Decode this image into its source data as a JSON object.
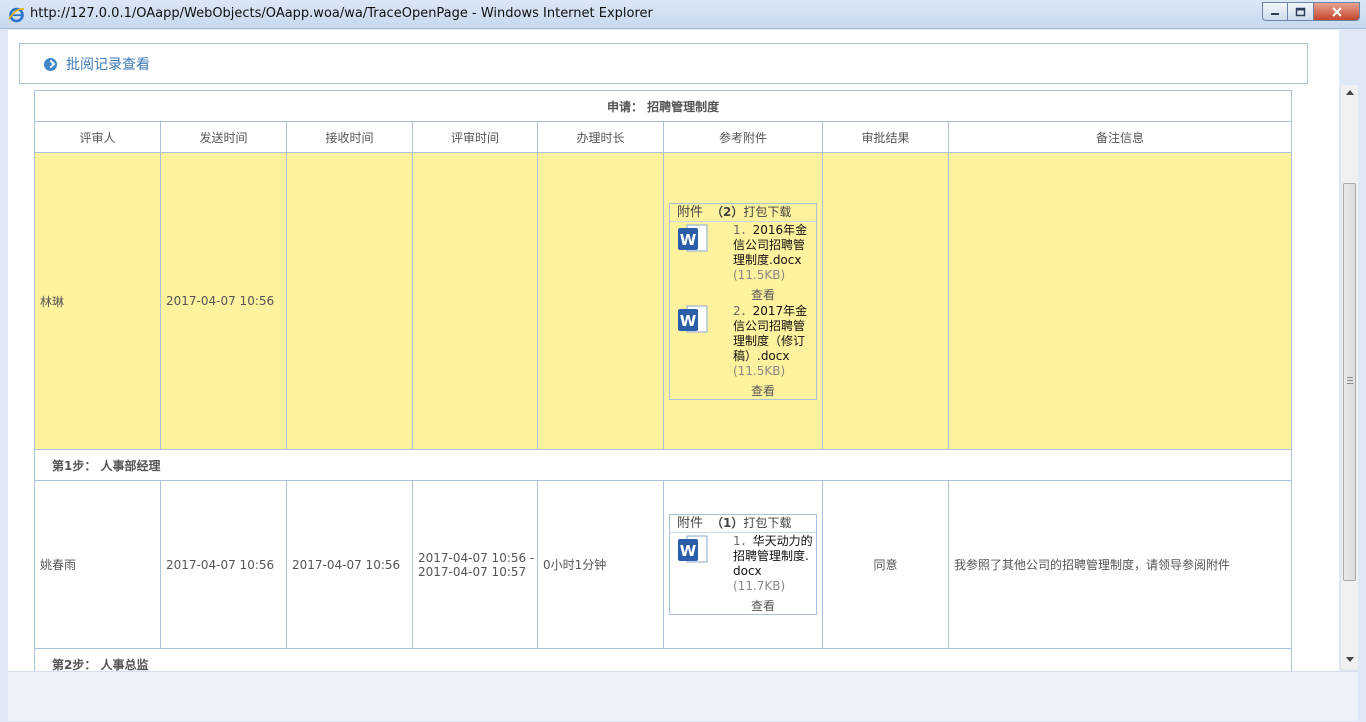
{
  "window": {
    "title": "http://127.0.0.1/OAapp/WebObjects/OAapp.woa/wa/TraceOpenPage - Windows Internet Explorer"
  },
  "panel": {
    "title": "批阅记录查看"
  },
  "table": {
    "apply_label": "申请：",
    "apply_name": "招聘管理制度",
    "columns": [
      "评审人",
      "发送时间",
      "接收时间",
      "评审时间",
      "办理时长",
      "参考附件",
      "审批结果",
      "备注信息"
    ],
    "rows": [
      {
        "reviewer": "林琳",
        "send_time": "2017-04-07 10:56",
        "receive_time": "",
        "review_time": "",
        "duration": "",
        "result": "",
        "remark": "",
        "attachments": {
          "label": "附件",
          "count": "（2）",
          "download": "打包下载",
          "items": [
            {
              "num": "1．",
              "name": "2016年金信公司招聘管理制度.docx",
              "size": "(11.5KB)",
              "view": "查看"
            },
            {
              "num": "2．",
              "name": "2017年金信公司招聘管理制度（修订稿）.docx",
              "size": "(11.5KB)",
              "view": "查看"
            }
          ]
        }
      },
      {
        "step_label": "第1步：",
        "step_name": "人事部经理",
        "reviewer": "姚春雨",
        "send_time": "2017-04-07 10:56",
        "receive_time": "2017-04-07 10:56",
        "review_time_start": "2017-04-07 10:56 -",
        "review_time_end": "2017-04-07 10:57",
        "duration": "0小时1分钟",
        "result": "同意",
        "remark": "我参照了其他公司的招聘管理制度，请领导参阅附件",
        "attachments": {
          "label": "附件",
          "count": "（1）",
          "download": "打包下载",
          "items": [
            {
              "num": "1．",
              "name": "华天动力的招聘管理制度.docx",
              "size": "(11.7KB)",
              "view": "查看"
            }
          ]
        }
      }
    ],
    "next_step_label": "第2步：",
    "next_step_name": "人事总监"
  },
  "icons": {
    "browser": "ie-icon",
    "panel": "circle-arrow-icon",
    "attachment": "word-doc-icon"
  },
  "colors": {
    "highlight_row": "#fff29f",
    "border": "#a9c2da",
    "title_blue": "#3b7ab8"
  }
}
